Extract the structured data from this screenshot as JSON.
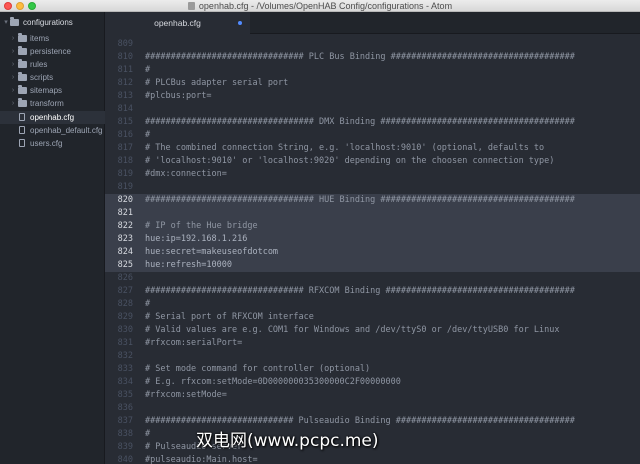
{
  "window": {
    "title": "openhab.cfg - /Volumes/OpenHAB Config/configurations - Atom"
  },
  "sidebar": {
    "root": "configurations",
    "items": [
      {
        "label": "items",
        "kind": "folder"
      },
      {
        "label": "persistence",
        "kind": "folder"
      },
      {
        "label": "rules",
        "kind": "folder"
      },
      {
        "label": "scripts",
        "kind": "folder"
      },
      {
        "label": "sitemaps",
        "kind": "folder"
      },
      {
        "label": "transform",
        "kind": "folder"
      },
      {
        "label": "openhab.cfg",
        "kind": "file",
        "selected": true
      },
      {
        "label": "openhab_default.cfg",
        "kind": "file"
      },
      {
        "label": "users.cfg",
        "kind": "file"
      }
    ]
  },
  "tab": {
    "label": "openhab.cfg",
    "modified_color": "#528bff"
  },
  "editor": {
    "highlight_color": "#3a3f4b",
    "lines": [
      {
        "num": "809",
        "text": ""
      },
      {
        "num": "810",
        "text": "############################### PLC Bus Binding ####################################"
      },
      {
        "num": "811",
        "text": "#"
      },
      {
        "num": "812",
        "text": "# PLCBus adapter serial port"
      },
      {
        "num": "813",
        "text": "#plcbus:port="
      },
      {
        "num": "814",
        "text": ""
      },
      {
        "num": "815",
        "text": "################################# DMX Binding ######################################"
      },
      {
        "num": "816",
        "text": "#"
      },
      {
        "num": "817",
        "text": "# The combined connection String, e.g. 'localhost:9010' (optional, defaults to"
      },
      {
        "num": "818",
        "text": "# 'localhost:9010' or 'localhost:9020' depending on the choosen connection type)"
      },
      {
        "num": "819",
        "text": "#dmx:connection="
      },
      {
        "num": "819b",
        "text": ""
      },
      {
        "num": "820",
        "text": "################################# HUE Binding ######################################"
      },
      {
        "num": "821",
        "text": ""
      },
      {
        "num": "822",
        "text": "# IP of the Hue bridge"
      },
      {
        "num": "823",
        "text": "hue:ip=192.168.1.216"
      },
      {
        "num": "824",
        "text": "hue:secret=makeuseofdotcom"
      },
      {
        "num": "825",
        "text": "hue:refresh=10000"
      },
      {
        "num": "826",
        "text": ""
      },
      {
        "num": "827",
        "text": "############################### RFXCOM Binding #####################################"
      },
      {
        "num": "828",
        "text": "#"
      },
      {
        "num": "829",
        "text": "# Serial port of RFXCOM interface"
      },
      {
        "num": "830",
        "text": "# Valid values are e.g. COM1 for Windows and /dev/ttyS0 or /dev/ttyUSB0 for Linux"
      },
      {
        "num": "831",
        "text": "#rfxcom:serialPort="
      },
      {
        "num": "832",
        "text": ""
      },
      {
        "num": "833",
        "text": "# Set mode command for controller (optional)"
      },
      {
        "num": "834",
        "text": "# E.g. rfxcom:setMode=0D000000035300000C2F00000000"
      },
      {
        "num": "835",
        "text": "#rfxcom:setMode="
      },
      {
        "num": "836",
        "text": ""
      },
      {
        "num": "837",
        "text": "############################# Pulseaudio Binding ###################################"
      },
      {
        "num": "838",
        "text": "#"
      },
      {
        "num": "839",
        "text": "# Pulseaudio server"
      },
      {
        "num": "840",
        "text": "#pulseaudio:Main.host="
      }
    ]
  },
  "watermark": "双电网(www.pcpc.me)"
}
